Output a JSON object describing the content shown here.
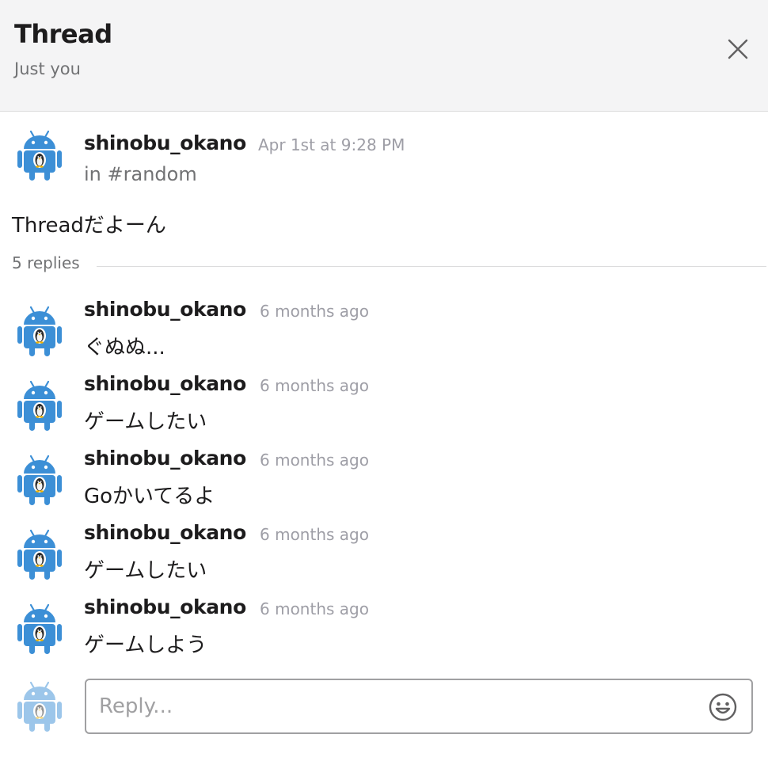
{
  "header": {
    "title": "Thread",
    "subtitle": "Just you",
    "close_icon": "close-icon"
  },
  "parent": {
    "author": "shinobu_okano",
    "timestamp": "Apr 1st at 9:28 PM",
    "channel": "in #random",
    "text": "Threadだよーん",
    "avatar_icon": "android-robot-avatar"
  },
  "replies_label": "5 replies",
  "replies": [
    {
      "author": "shinobu_okano",
      "time": "6 months ago",
      "text": "ぐぬぬ..."
    },
    {
      "author": "shinobu_okano",
      "time": "6 months ago",
      "text": "ゲームしたい"
    },
    {
      "author": "shinobu_okano",
      "time": "6 months ago",
      "text": "Goかいてるよ"
    },
    {
      "author": "shinobu_okano",
      "time": "6 months ago",
      "text": "ゲームしたい"
    },
    {
      "author": "shinobu_okano",
      "time": "6 months ago",
      "text": "ゲームしよう"
    }
  ],
  "composer": {
    "placeholder": "Reply...",
    "value": "",
    "emoji_icon": "emoji-smiley-icon"
  },
  "colors": {
    "header_bg": "#f4f4f5",
    "android_blue": "#3c8fd6",
    "muted_text": "#717274",
    "timestamp_text": "#9e9ea6"
  }
}
